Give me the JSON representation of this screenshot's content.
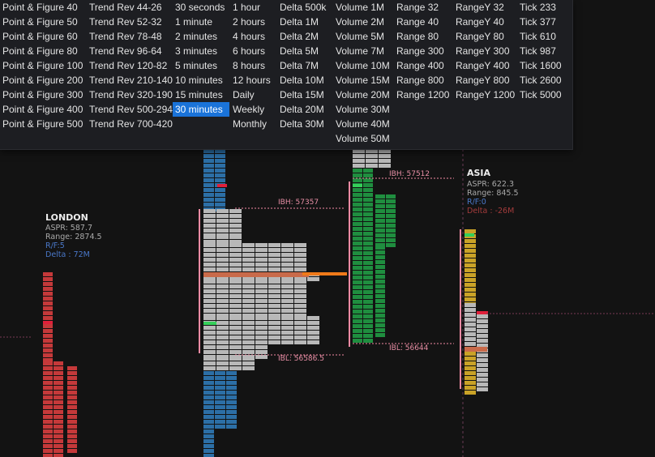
{
  "menu": {
    "columns": [
      [
        "Point & Figure 40",
        "Point & Figure 50",
        "Point & Figure 60",
        "Point & Figure 80",
        "Point & Figure 100",
        "Point & Figure 200",
        "Point & Figure 300",
        "Point & Figure 400",
        "Point & Figure 500"
      ],
      [
        "Trend Rev 44-26",
        "Trend Rev 52-32",
        "Trend Rev 78-48",
        "Trend Rev 96-64",
        "Trend Rev 120-82",
        "Trend Rev 210-140",
        "Trend Rev 320-190",
        "Trend Rev 500-294",
        "Trend Rev 700-420"
      ],
      [
        "30 seconds",
        "1 minute",
        "2 minutes",
        "3 minutes",
        "5 minutes",
        "10 minutes",
        "15 minutes",
        "30 minutes"
      ],
      [
        "1 hour",
        "2 hours",
        "4 hours",
        "6 hours",
        "8 hours",
        "12 hours",
        "Daily",
        "Weekly",
        "Monthly"
      ],
      [
        "Delta 500k",
        "Delta 1M",
        "Delta 2M",
        "Delta 5M",
        "Delta 7M",
        "Delta 10M",
        "Delta 15M",
        "Delta 20M",
        "Delta 30M"
      ],
      [
        "Volume 1M",
        "Volume 2M",
        "Volume 5M",
        "Volume 7M",
        "Volume 10M",
        "Volume 15M",
        "Volume 20M",
        "Volume 30M",
        "Volume 40M",
        "Volume 50M"
      ],
      [
        "Range 32",
        "Range 40",
        "Range 80",
        "Range 300",
        "Range 400",
        "Range 800",
        "Range 1200"
      ],
      [
        "RangeY 32",
        "RangeY 40",
        "RangeY 80",
        "RangeY 300",
        "RangeY 400",
        "RangeY 800",
        "RangeY 1200"
      ],
      [
        "Tick 233",
        "Tick 377",
        "Tick 610",
        "Tick 987",
        "Tick 1600",
        "Tick 2600",
        "Tick 5000"
      ]
    ],
    "selected": "30 minutes"
  },
  "sessions": {
    "london": {
      "title": "LONDON",
      "aspr": "ASPR: 587.7",
      "range": "Range: 2874.5",
      "rf": "R/F:5",
      "delta": "Delta : 72M"
    },
    "asia": {
      "title": "ASIA",
      "aspr": "ASPR: 622.3",
      "range": "Range: 845.5",
      "rf": "R/F:0",
      "delta": "Delta : -26M"
    }
  },
  "levels": {
    "ibh_1": "IBH: 57357",
    "ibl_1": "IBL: 56586.5",
    "ibh_2": "IBH: 57512",
    "ibl_2": "IBL: 56644"
  },
  "colors": {
    "london": "#c5393a",
    "ny": "#2c6fa6",
    "profile": "#b8b8b8",
    "green": "#1f8e3f",
    "asia": "#c9a227",
    "poc": "#f07a1a",
    "ib_line": "#f08aa3",
    "marker_green": "#35d05a",
    "marker_red": "#e0203a",
    "menu_bg": "#1d1e22",
    "menu_selected": "#1a73d9"
  }
}
